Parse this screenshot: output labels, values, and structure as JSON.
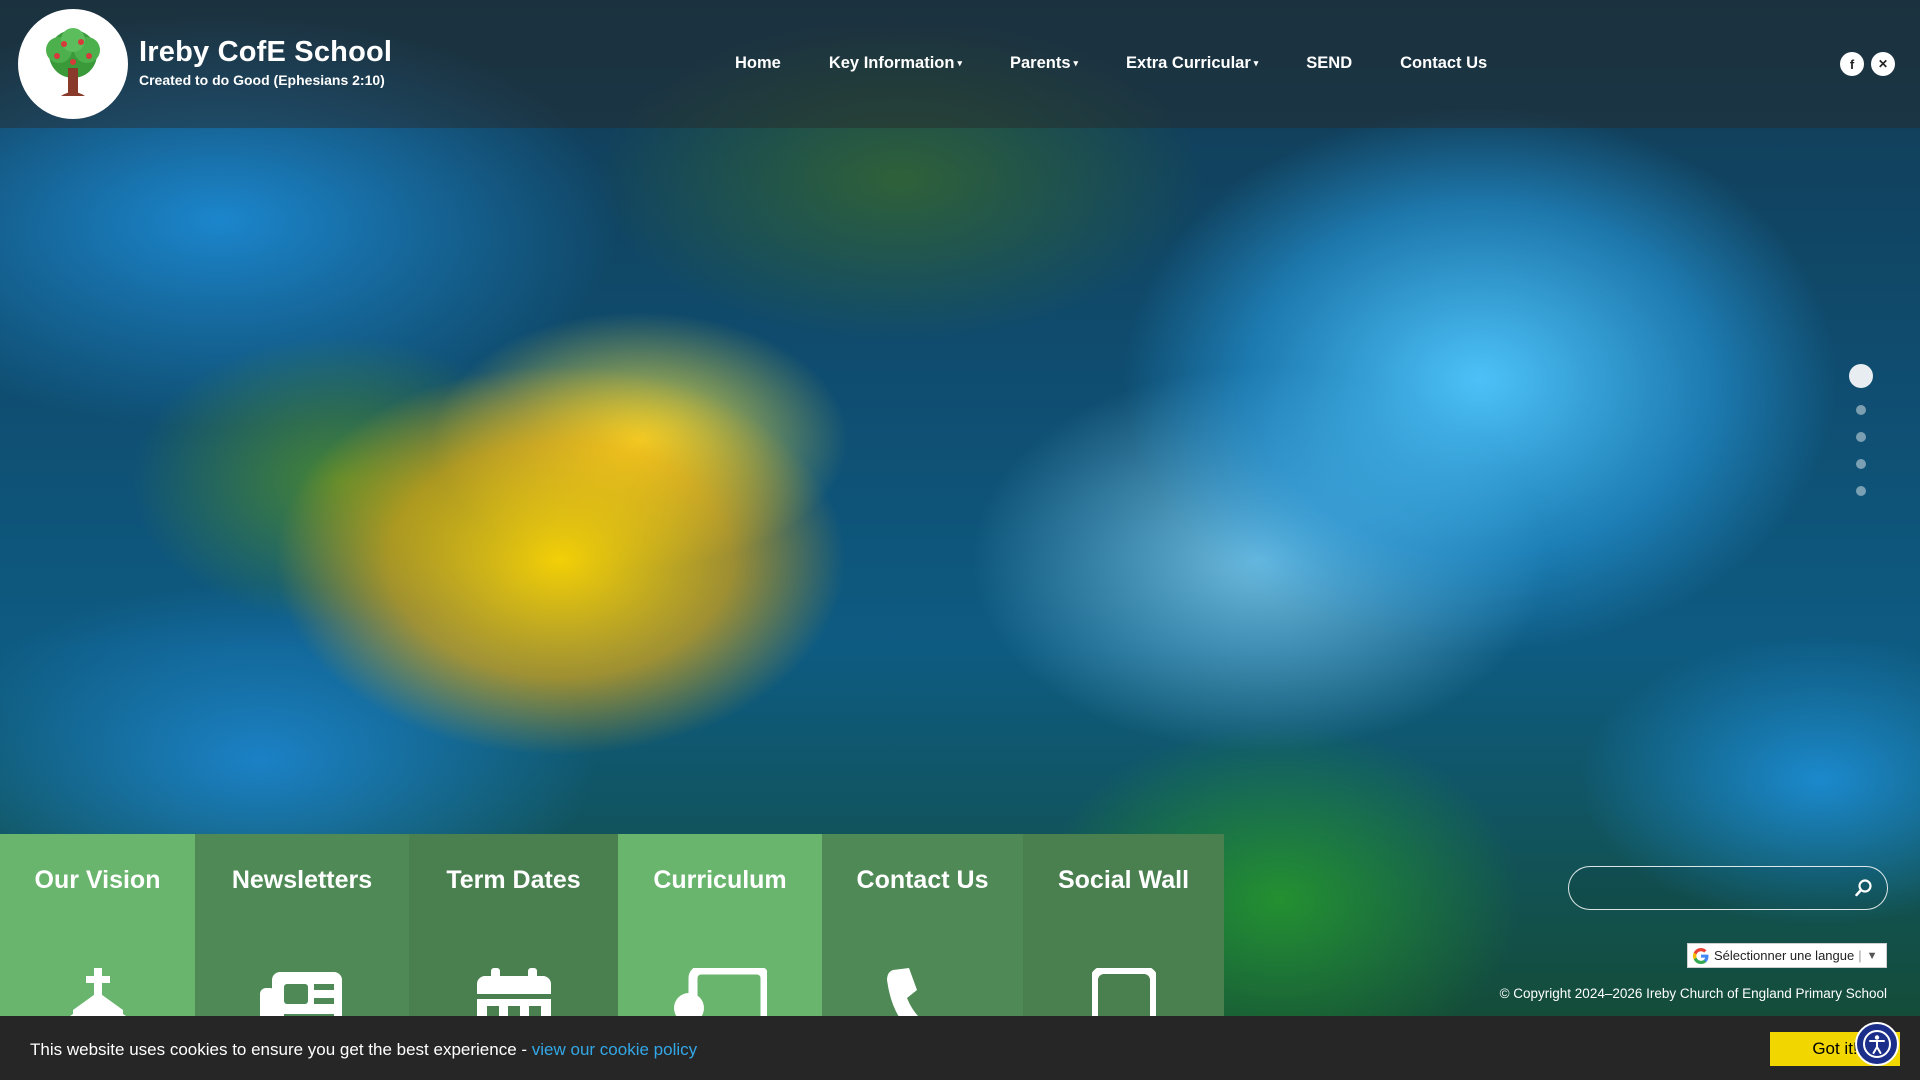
{
  "school": {
    "name": "Ireby CofE School",
    "motto": "Created to do Good (Ephesians 2:10)"
  },
  "nav": {
    "items": [
      {
        "label": "Home",
        "dropdown": false
      },
      {
        "label": "Key Information",
        "dropdown": true
      },
      {
        "label": "Parents",
        "dropdown": true
      },
      {
        "label": "Extra Curricular",
        "dropdown": true
      },
      {
        "label": "SEND",
        "dropdown": false
      },
      {
        "label": "Contact Us",
        "dropdown": false
      }
    ]
  },
  "social": {
    "facebook": "f",
    "x": "✕"
  },
  "slider": {
    "slide_count": 5,
    "active_index": 0
  },
  "quick_links": [
    {
      "label": "Our Vision",
      "icon": "church-icon",
      "style": "light"
    },
    {
      "label": "Newsletters",
      "icon": "newspaper-icon",
      "style": "dark"
    },
    {
      "label": "Term Dates",
      "icon": "calendar-icon",
      "style": "darker"
    },
    {
      "label": "Curriculum",
      "icon": "teacher-board-icon",
      "style": "light"
    },
    {
      "label": "Contact Us",
      "icon": "phone-icon",
      "style": "dark"
    },
    {
      "label": "Social Wall",
      "icon": "mobile-phone-icon",
      "style": "darker"
    }
  ],
  "search": {
    "value": "",
    "placeholder": ""
  },
  "translate": {
    "label": "Sélectionner une langue"
  },
  "footer": {
    "copyright": "© Copyright 2024–2026 Ireby Church of England Primary School"
  },
  "cookie": {
    "message": "This website uses cookies to ensure you get the best experience - ",
    "link_text": "view our cookie policy",
    "button_label": "Got it!"
  },
  "colors": {
    "tile_light": "#6ab56e",
    "tile_dark": "#4f8a56",
    "cookie_button": "#f1d600",
    "cookie_link": "#33a7e6",
    "accessibility_button": "#1b2f8a"
  }
}
